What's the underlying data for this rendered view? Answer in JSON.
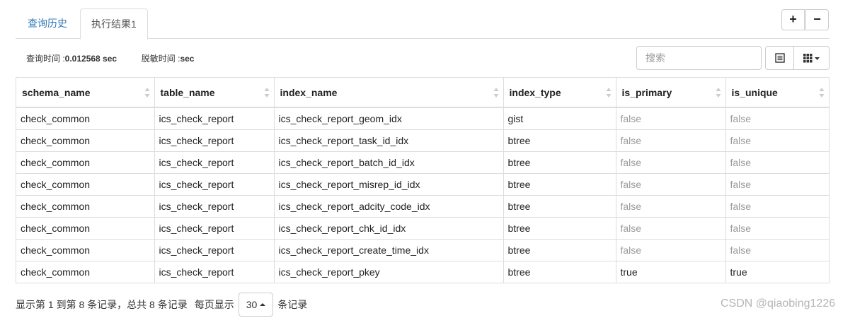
{
  "tabs": [
    {
      "label": "查询历史"
    },
    {
      "label": "执行结果1"
    }
  ],
  "toolbar": {
    "plus_label": "+",
    "minus_label": "−",
    "search_placeholder": "搜索"
  },
  "stats": {
    "query_time_label": "查询时间 : ",
    "query_time_value": "0.012568 sec",
    "mask_time_label": "脱敏时间 : ",
    "mask_time_value": "sec"
  },
  "table": {
    "columns": [
      "schema_name",
      "table_name",
      "index_name",
      "index_type",
      "is_primary",
      "is_unique"
    ],
    "rows": [
      [
        "check_common",
        "ics_check_report",
        "ics_check_report_geom_idx",
        "gist",
        "false",
        "false"
      ],
      [
        "check_common",
        "ics_check_report",
        "ics_check_report_task_id_idx",
        "btree",
        "false",
        "false"
      ],
      [
        "check_common",
        "ics_check_report",
        "ics_check_report_batch_id_idx",
        "btree",
        "false",
        "false"
      ],
      [
        "check_common",
        "ics_check_report",
        "ics_check_report_misrep_id_idx",
        "btree",
        "false",
        "false"
      ],
      [
        "check_common",
        "ics_check_report",
        "ics_check_report_adcity_code_idx",
        "btree",
        "false",
        "false"
      ],
      [
        "check_common",
        "ics_check_report",
        "ics_check_report_chk_id_idx",
        "btree",
        "false",
        "false"
      ],
      [
        "check_common",
        "ics_check_report",
        "ics_check_report_create_time_idx",
        "btree",
        "false",
        "false"
      ],
      [
        "check_common",
        "ics_check_report",
        "ics_check_report_pkey",
        "btree",
        "true",
        "true"
      ]
    ]
  },
  "pagination": {
    "summary": "显示第 1 到第 8 条记录，总共 8 条记录",
    "per_page_label": "每页显示",
    "page_size": "30",
    "records_label": "条记录"
  },
  "watermark": "CSDN @qiaobing1226",
  "icons": {
    "list": "list-icon",
    "columns": "grid-columns-icon",
    "sort": "sort-icon"
  },
  "colors": {
    "tab_link": "#337ab7",
    "muted_text": "#999999",
    "border": "#dddddd"
  }
}
